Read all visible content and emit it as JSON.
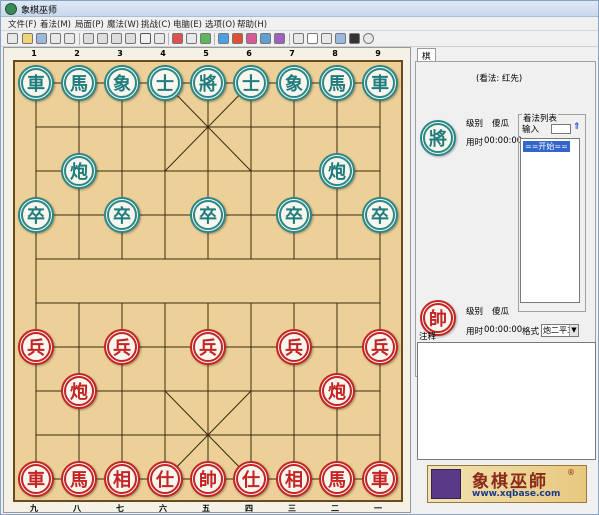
{
  "window": {
    "title": "象棋巫师"
  },
  "menu": [
    "文件(F)",
    "着法(M)",
    "局面(P)",
    "魔法(W)",
    "挑战(C)",
    "电脑(E)",
    "选项(O)",
    "帮助(H)"
  ],
  "board": {
    "top_files": [
      "1",
      "2",
      "3",
      "4",
      "5",
      "6",
      "7",
      "8",
      "9"
    ],
    "bottom_files": [
      "九",
      "八",
      "七",
      "六",
      "五",
      "四",
      "三",
      "二",
      "一"
    ],
    "black_back": [
      "車",
      "馬",
      "象",
      "士",
      "將",
      "士",
      "象",
      "馬",
      "車"
    ],
    "black_cannon": [
      "炮",
      "炮"
    ],
    "black_pawns": [
      "卒",
      "卒",
      "卒",
      "卒",
      "卒"
    ],
    "red_pawns": [
      "兵",
      "兵",
      "兵",
      "兵",
      "兵"
    ],
    "red_cannon": [
      "炮",
      "炮"
    ],
    "red_back": [
      "車",
      "馬",
      "相",
      "仕",
      "帥",
      "仕",
      "相",
      "馬",
      "車"
    ]
  },
  "side": {
    "tab": "棋局信息",
    "view_label": "(看法: 红先)",
    "black_piece": "將",
    "red_piece": "帥",
    "level_label": "级别",
    "level_value": "傻瓜",
    "time_label": "用时",
    "time_value": "00:00:00",
    "movelist_title": "着法列表",
    "input_label": "输入",
    "first_move": "==开始==",
    "format_label": "格式",
    "format_value": "炮二平3",
    "notes_label": "注释",
    "banner_title": "象棋巫師",
    "banner_mark": "®",
    "banner_url": "www.xqbase.com"
  },
  "colors": {
    "black_piece": "#1f7c7c",
    "red_piece": "#c42424",
    "board": "#ecd097"
  }
}
